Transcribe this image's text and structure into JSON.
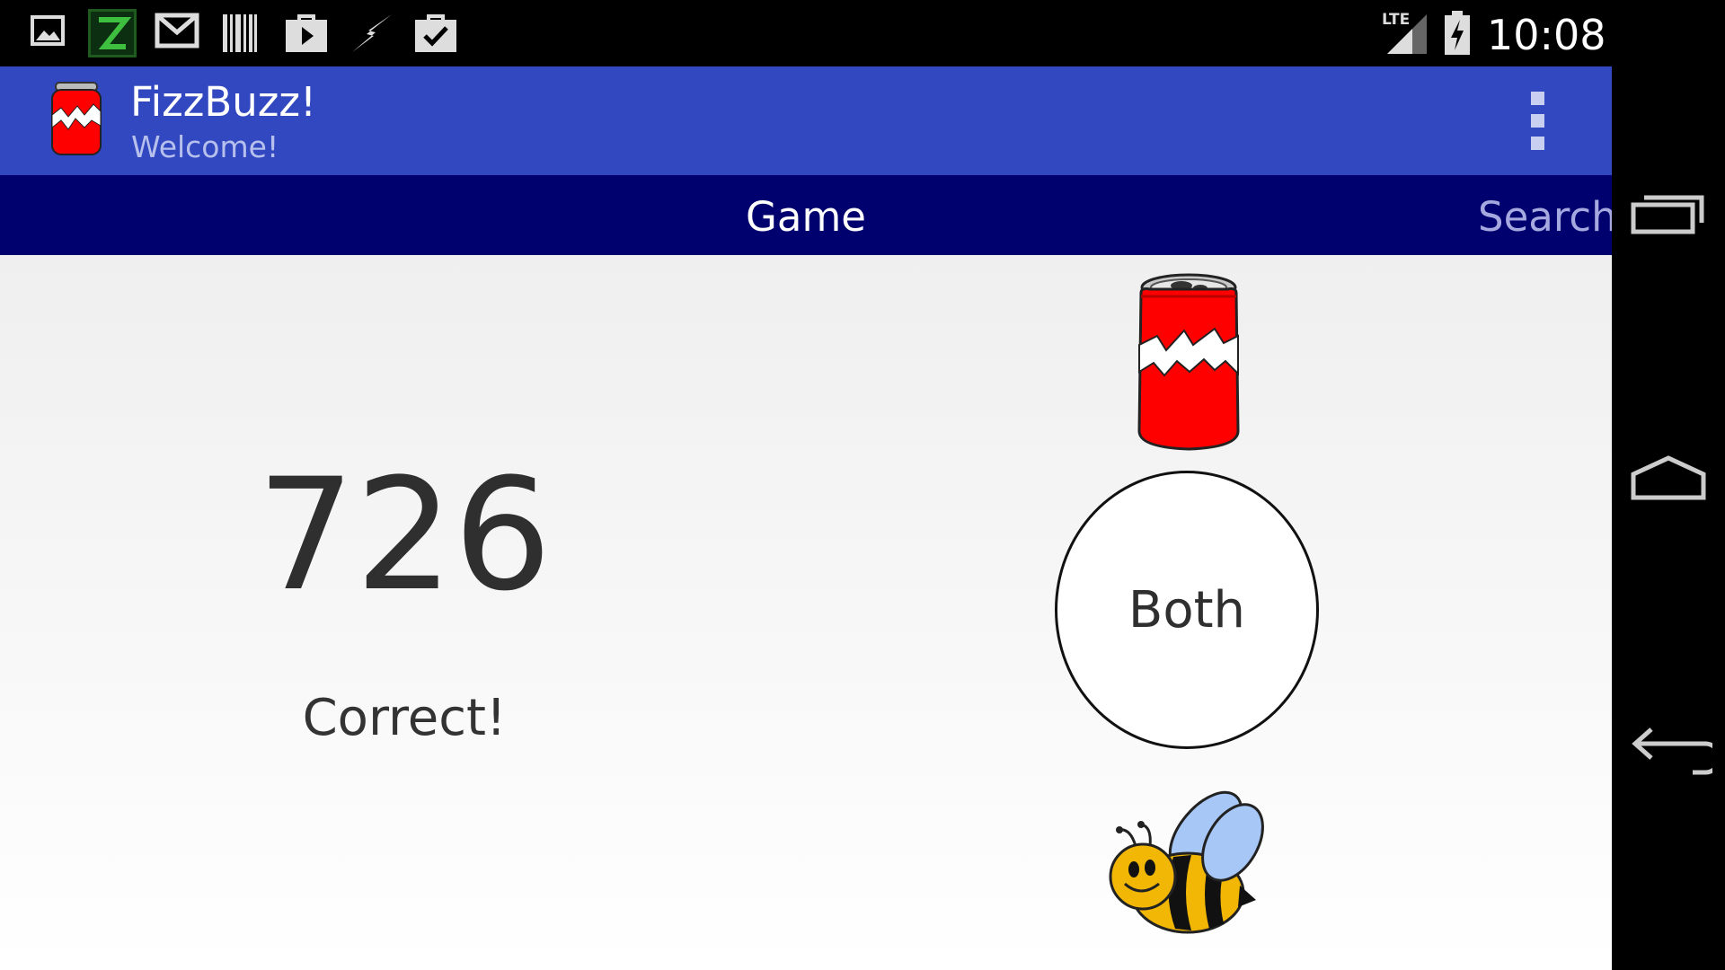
{
  "status_bar": {
    "time": "10:08",
    "network_label": "LTE",
    "notification_icons": [
      "gallery-icon",
      "z-app-icon",
      "gmail-icon",
      "barcode-icon",
      "play-store-icon",
      "flash-icon",
      "shopping-bag-check-icon"
    ]
  },
  "action_bar": {
    "title": "FizzBuzz!",
    "subtitle": "Welcome!"
  },
  "tabs": [
    {
      "label": "Game",
      "selected": true
    },
    {
      "label": "Search",
      "selected": false
    }
  ],
  "game": {
    "number": "726",
    "feedback": "Correct!",
    "buttons": {
      "fizz_icon": "soda-can-icon",
      "both_label": "Both",
      "buzz_icon": "bee-icon"
    }
  },
  "nav_bar": {
    "buttons": [
      "recent-apps-icon",
      "home-icon",
      "back-icon"
    ]
  },
  "colors": {
    "action_bar": "#3248C0",
    "tab_bar": "#00006E",
    "content_bg": "#F5F5F5",
    "can_red": "#FF0000",
    "bee_yellow": "#F2B705",
    "wing_blue": "#A7C7F7"
  }
}
